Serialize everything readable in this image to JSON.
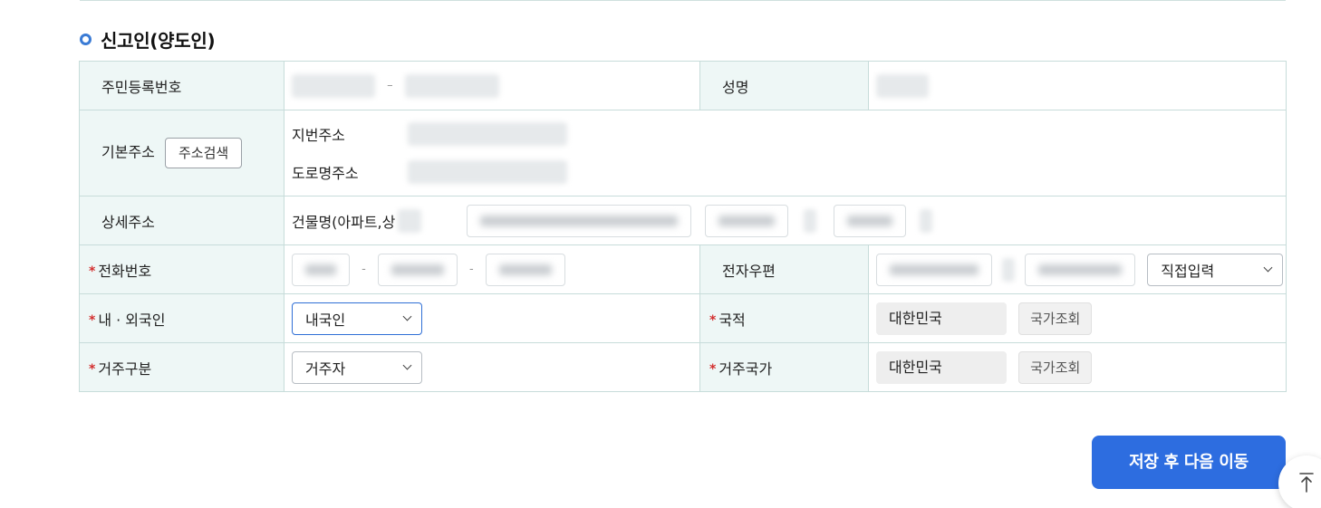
{
  "section": {
    "title": "신고인(양도인)"
  },
  "rows": {
    "rrn_label": "주민등록번호",
    "name_label": "성명",
    "address_label": "기본주소",
    "address_search": "주소검색",
    "jibun_label": "지번주소",
    "road_label": "도로명주소",
    "detail_label": "상세주소",
    "building_label": "건물명(아파트,상",
    "phone_label": "전화번호",
    "email_label": "전자우편",
    "email_select": "직접입력",
    "nationality_type_label": "내 · 외국인",
    "nationality_type_value": "내국인",
    "country_label": "국적",
    "country_value": "대한민국",
    "country_lookup": "국가조회",
    "residence_label": "거주구분",
    "residence_value": "거주자",
    "residence_country_label": "거주국가",
    "residence_country_value": "대한민국",
    "residence_country_lookup": "국가조회",
    "required_mark": "*"
  },
  "actions": {
    "save_next": "저장 후 다음 이동"
  },
  "icons": {
    "section_bullet": "ring-bullet-icon",
    "scroll_top": "arrow-up-to-top-icon",
    "select_chevron": "chevron-down-icon"
  },
  "colors": {
    "accent": "#2d6de0",
    "label_bg": "#eef7f6",
    "border": "#c7dcda",
    "required": "#d32f2f"
  }
}
